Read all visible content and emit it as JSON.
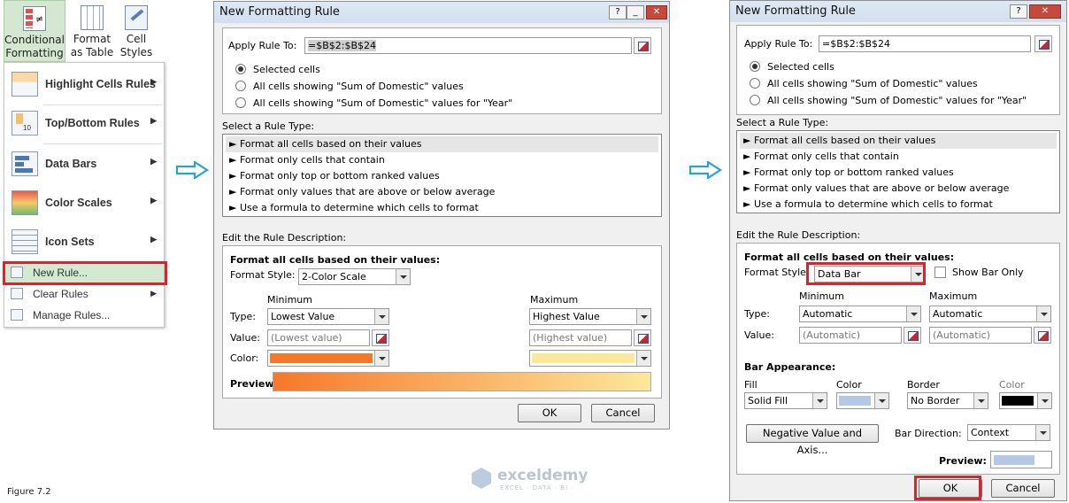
{
  "ribbon": {
    "conditional_formatting": "Conditional Formatting",
    "format_as_table": "Format as Table",
    "cell_styles": "Cell Styles"
  },
  "menu": {
    "highlight": "Highlight Cells Rules",
    "topbottom": "Top/Bottom Rules",
    "databars": "Data Bars",
    "colorscales": "Color Scales",
    "iconsets": "Icon Sets",
    "newrule": "New Rule...",
    "clearrules": "Clear Rules",
    "managerules": "Manage Rules..."
  },
  "caption": "Figure 7.2",
  "watermark": {
    "name": "exceldemy",
    "tag": "EXCEL · DATA · BI"
  },
  "dialog1": {
    "title": "New Formatting Rule",
    "apply_to_label": "Apply Rule To:",
    "apply_to_value": "=$B$2:$B$24",
    "radio": [
      "Selected cells",
      "All cells showing \"Sum of Domestic\" values",
      "All cells showing \"Sum of Domestic\" values for \"Year\""
    ],
    "select_type_label": "Select a Rule Type:",
    "rule_types": [
      "► Format all cells based on their values",
      "► Format only cells that contain",
      "► Format only top or bottom ranked values",
      "► Format only values that are above or below average",
      "► Use a formula to determine which cells to format"
    ],
    "edit_label": "Edit the Rule Description:",
    "desc_heading": "Format all cells based on their values:",
    "format_style_label": "Format Style:",
    "format_style": "2-Color Scale",
    "minimum": "Minimum",
    "maximum": "Maximum",
    "type_label": "Type:",
    "value_label": "Value:",
    "color_label": "Color:",
    "type_min": "Lowest Value",
    "type_max": "Highest Value",
    "value_min": "(Lowest value)",
    "value_max": "(Highest value)",
    "color_min": "#f7782a",
    "color_max": "#fde89a",
    "preview_label": "Preview:",
    "ok": "OK",
    "cancel": "Cancel"
  },
  "dialog2": {
    "title": "New Formatting Rule",
    "apply_to_label": "Apply Rule To:",
    "apply_to_value": "=$B$2:$B$24",
    "radio": [
      "Selected cells",
      "All cells showing \"Sum of Domestic\" values",
      "All cells showing \"Sum of Domestic\" values for \"Year\""
    ],
    "select_type_label": "Select a Rule Type:",
    "rule_types": [
      "► Format all cells based on their values",
      "► Format only cells that contain",
      "► Format only top or bottom ranked values",
      "► Format only values that are above or below average",
      "► Use a formula to determine which cells to format"
    ],
    "edit_label": "Edit the Rule Description:",
    "desc_heading": "Format all cells based on their values:",
    "format_style_label": "Format Style:",
    "format_style": "Data Bar",
    "show_bar_only": "Show Bar Only",
    "minimum": "Minimum",
    "maximum": "Maximum",
    "type_label": "Type:",
    "value_label": "Value:",
    "type_min": "Automatic",
    "type_max": "Automatic",
    "value_min": "(Automatic)",
    "value_max": "(Automatic)",
    "bar_appearance": "Bar Appearance:",
    "fill_label": "Fill",
    "color_label": "Color",
    "border_label": "Border",
    "color2_label": "Color",
    "fill": "Solid Fill",
    "border": "No Border",
    "bar_color": "#b4c8e6",
    "border_color": "#000000",
    "negative_btn": "Negative Value and Axis...",
    "bar_direction_label": "Bar Direction:",
    "bar_direction": "Context",
    "preview_label": "Preview:",
    "ok": "OK",
    "cancel": "Cancel"
  }
}
